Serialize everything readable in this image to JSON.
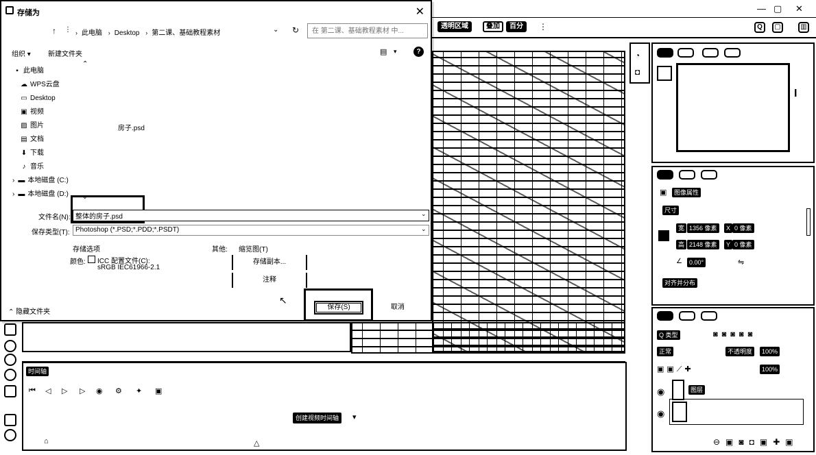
{
  "app": {
    "toolbar": {
      "transparent_region_label": "透明区域",
      "chip_overlay_label": "叠加",
      "chip_percent_label": "百分"
    },
    "right_panels": {
      "properties_image_label": "图像属性",
      "width_label": "宽",
      "width_value": "1356 像素",
      "x_label": "X",
      "x_value": "0 像素",
      "height_label": "高",
      "height_value": "2148 像素",
      "y_label": "Y",
      "y_value": "0 像素",
      "size_label": "尺寸",
      "angle_value": "0.00°",
      "align_distribute_label": "对齐并分布",
      "layers_search_label": "Q 类型",
      "blend_mode": "正常",
      "opacity_label": "不透明度",
      "opacity_value": "100%",
      "fill_value": "100%",
      "layer_name": "图层"
    },
    "timeline": {
      "tab_label": "时间轴",
      "create_button_label": "创建视频时间轴"
    }
  },
  "dialog": {
    "title": "存储为",
    "breadcrumb": [
      "此电脑",
      "Desktop",
      "第二课、基础教程素材"
    ],
    "search_placeholder": "在 第二课、基础教程素材 中...",
    "cmd": {
      "organize_label": "组织",
      "new_folder_label": "新建文件夹"
    },
    "nav_items": [
      {
        "icon": "computer-icon",
        "glyph": "▪",
        "label": "此电脑"
      },
      {
        "icon": "cloud-icon",
        "glyph": "☁",
        "label": "WPS云盘"
      },
      {
        "icon": "desktop-icon",
        "glyph": "▭",
        "label": "Desktop"
      },
      {
        "icon": "video-icon",
        "glyph": "▣",
        "label": "视频"
      },
      {
        "icon": "picture-icon",
        "glyph": "▨",
        "label": "图片"
      },
      {
        "icon": "document-icon",
        "glyph": "▤",
        "label": "文档"
      },
      {
        "icon": "download-icon",
        "glyph": "⬇",
        "label": "下载"
      },
      {
        "icon": "music-icon",
        "glyph": "♪",
        "label": "音乐"
      },
      {
        "icon": "drive-c-icon",
        "glyph": "▬",
        "label": "本地磁盘 (C:)"
      },
      {
        "icon": "drive-d-icon",
        "glyph": "▬",
        "label": "本地磁盘 (D:)"
      }
    ],
    "files": [
      "房子.psd"
    ],
    "filename_label": "文件名(N):",
    "filename_value": "整体的房子.psd",
    "filetype_label": "保存类型(T):",
    "filetype_value": "Photoshop (*.PSD;*.PDD;*.PSDT)",
    "save_options_label": "存储选项",
    "other_label": "其他:",
    "thumbnail_label": "缩览图(T)",
    "color_label": "颜色:",
    "icc_label": "ICC 配置文件(C):",
    "icc_profile": "sRGB IEC61966-2.1",
    "icc_checked": false,
    "save_copy_label": "存储副本...",
    "notes_label": "注释",
    "hide_folders_label": "隐藏文件夹",
    "save_button_label": "保存(S)",
    "cancel_button_label": "取消"
  }
}
